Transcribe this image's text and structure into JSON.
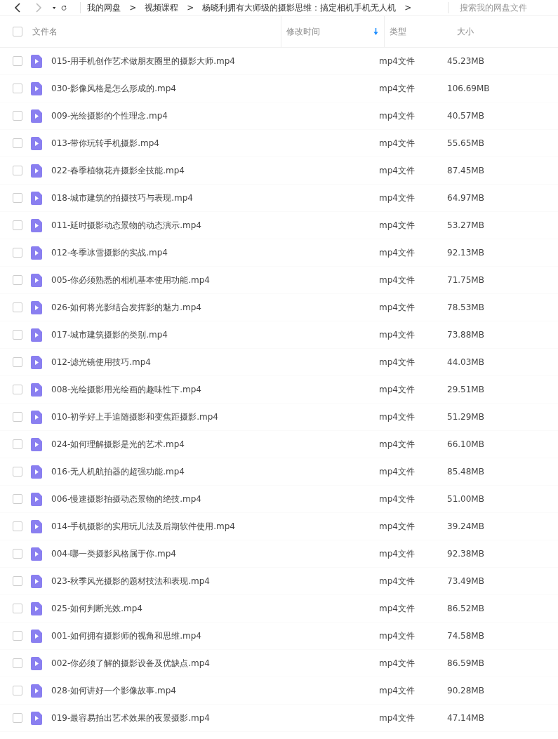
{
  "nav": {
    "back_disabled": false,
    "forward_disabled": true
  },
  "breadcrumb": [
    "我的网盘",
    "视频课程",
    "杨晓利拥有大师级的摄影思维：搞定相机手机无人机"
  ],
  "breadcrumb_separator": ">",
  "search": {
    "placeholder": "搜索我的网盘文件"
  },
  "table": {
    "select_all": {
      "checked": false
    },
    "columns": [
      {
        "label": "文件名",
        "sorted": false
      },
      {
        "label": "修改时间",
        "sorted": true
      },
      {
        "label": "类型",
        "sorted": false
      },
      {
        "label": "大小",
        "sorted": false
      }
    ],
    "rows": [
      {
        "name": "015-用手机创作艺术做朋友圈里的摄影大师.mp4",
        "type": "mp4文件",
        "size": "45.23MB",
        "checked": false
      },
      {
        "name": "030-影像风格是怎么形成的.mp4",
        "type": "mp4文件",
        "size": "106.69MB",
        "checked": false
      },
      {
        "name": "009-光绘摄影的个性理念.mp4",
        "type": "mp4文件",
        "size": "40.57MB",
        "checked": false
      },
      {
        "name": "013-带你玩转手机摄影.mp4",
        "type": "mp4文件",
        "size": "55.65MB",
        "checked": false
      },
      {
        "name": "022-春季植物花卉摄影全技能.mp4",
        "type": "mp4文件",
        "size": "87.45MB",
        "checked": false
      },
      {
        "name": "018-城市建筑的拍摄技巧与表现.mp4",
        "type": "mp4文件",
        "size": "64.97MB",
        "checked": false
      },
      {
        "name": "011-延时摄影动态景物的动态演示.mp4",
        "type": "mp4文件",
        "size": "53.27MB",
        "checked": false
      },
      {
        "name": "012-冬季冰雪摄影的实战.mp4",
        "type": "mp4文件",
        "size": "92.13MB",
        "checked": false
      },
      {
        "name": "005-你必须熟悉的相机基本使用功能.mp4",
        "type": "mp4文件",
        "size": "71.75MB",
        "checked": false
      },
      {
        "name": "026-如何将光影结合发挥影的魅力.mp4",
        "type": "mp4文件",
        "size": "78.53MB",
        "checked": false
      },
      {
        "name": "017-城市建筑摄影的类别.mp4",
        "type": "mp4文件",
        "size": "73.88MB",
        "checked": false
      },
      {
        "name": "012-滤光镜使用技巧.mp4",
        "type": "mp4文件",
        "size": "44.03MB",
        "checked": false
      },
      {
        "name": "008-光绘摄影用光绘画的趣味性下.mp4",
        "type": "mp4文件",
        "size": "29.51MB",
        "checked": false
      },
      {
        "name": "010-初学好上手追随摄影和变焦距摄影.mp4",
        "type": "mp4文件",
        "size": "51.29MB",
        "checked": false
      },
      {
        "name": "024-如何理解摄影是光的艺术.mp4",
        "type": "mp4文件",
        "size": "66.10MB",
        "checked": false
      },
      {
        "name": "016-无人机航拍器的超强功能.mp4",
        "type": "mp4文件",
        "size": "85.48MB",
        "checked": false
      },
      {
        "name": "006-慢速摄影拍摄动态景物的绝技.mp4",
        "type": "mp4文件",
        "size": "51.00MB",
        "checked": false
      },
      {
        "name": "014-手机摄影的实用玩儿法及后期软件使用.mp4",
        "type": "mp4文件",
        "size": "39.24MB",
        "checked": false
      },
      {
        "name": "004-哪一类摄影风格属于你.mp4",
        "type": "mp4文件",
        "size": "92.38MB",
        "checked": false
      },
      {
        "name": "023-秋季风光摄影的题材技法和表现.mp4",
        "type": "mp4文件",
        "size": "73.49MB",
        "checked": false
      },
      {
        "name": "025-如何判断光效.mp4",
        "type": "mp4文件",
        "size": "86.52MB",
        "checked": false
      },
      {
        "name": "001-如何拥有摄影师的视角和思维.mp4",
        "type": "mp4文件",
        "size": "74.58MB",
        "checked": false
      },
      {
        "name": "002-你必须了解的摄影设备及优缺点.mp4",
        "type": "mp4文件",
        "size": "86.59MB",
        "checked": false
      },
      {
        "name": "028-如何讲好一个影像故事.mp4",
        "type": "mp4文件",
        "size": "90.28MB",
        "checked": false
      },
      {
        "name": "019-最容易拍出艺术效果的夜景摄影.mp4",
        "type": "mp4文件",
        "size": "47.14MB",
        "checked": false
      }
    ]
  }
}
